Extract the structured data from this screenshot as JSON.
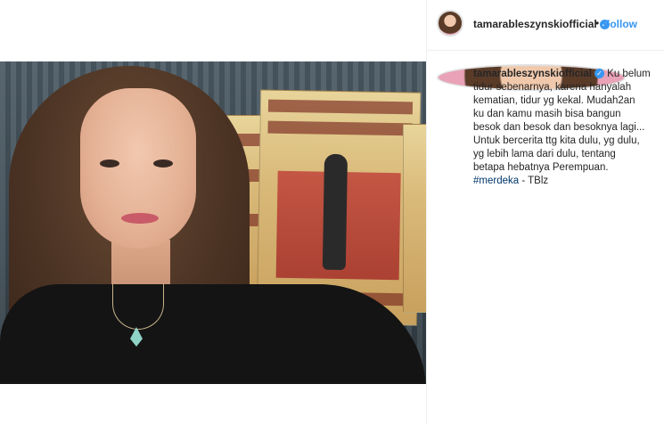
{
  "header": {
    "username": "tamarableszynskiofficial",
    "separator": "•",
    "follow_label": "Follow"
  },
  "caption": {
    "username": "tamarableszynskiofficial",
    "lines": [
      "Ku belum",
      "tidur sebenarnya, karena hanyalah",
      "kematian, tidur yg kekal. Mudah2an",
      "ku dan kamu masih bisa bangun",
      "besok dan besok dan besoknya lagi...",
      "Untuk bercerita ttg kita dulu, yg dulu,",
      "yg lebih lama dari dulu, tentang",
      "betapa hebatnya Perempuan."
    ],
    "hashtag": "#merdeka",
    "suffix": " - TBlz"
  },
  "colors": {
    "link_blue": "#3897f0",
    "hashtag": "#00376b"
  }
}
